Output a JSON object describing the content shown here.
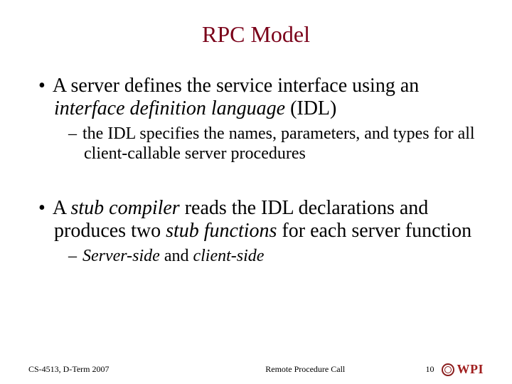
{
  "title": "RPC Model",
  "bullets": {
    "b1_pre": "A server defines the service interface using an ",
    "b1_italic": "interface definition language",
    "b1_post": " (IDL)",
    "b1_sub": "the IDL specifies the names, parameters, and types for all client-callable server procedures",
    "b2_pre": "A ",
    "b2_i1": "stub compiler",
    "b2_mid": " reads the IDL declarations and produces two ",
    "b2_i2": "stub functions",
    "b2_post": " for each server function",
    "b2_sub_i1": "Server-side",
    "b2_sub_mid": " and ",
    "b2_sub_i2": "client-side"
  },
  "footer": {
    "left": "CS-4513, D-Term 2007",
    "center": "Remote Procedure Call",
    "page": "10",
    "logo_text": "WPI"
  },
  "glyphs": {
    "bullet": "•",
    "dash": "–"
  }
}
